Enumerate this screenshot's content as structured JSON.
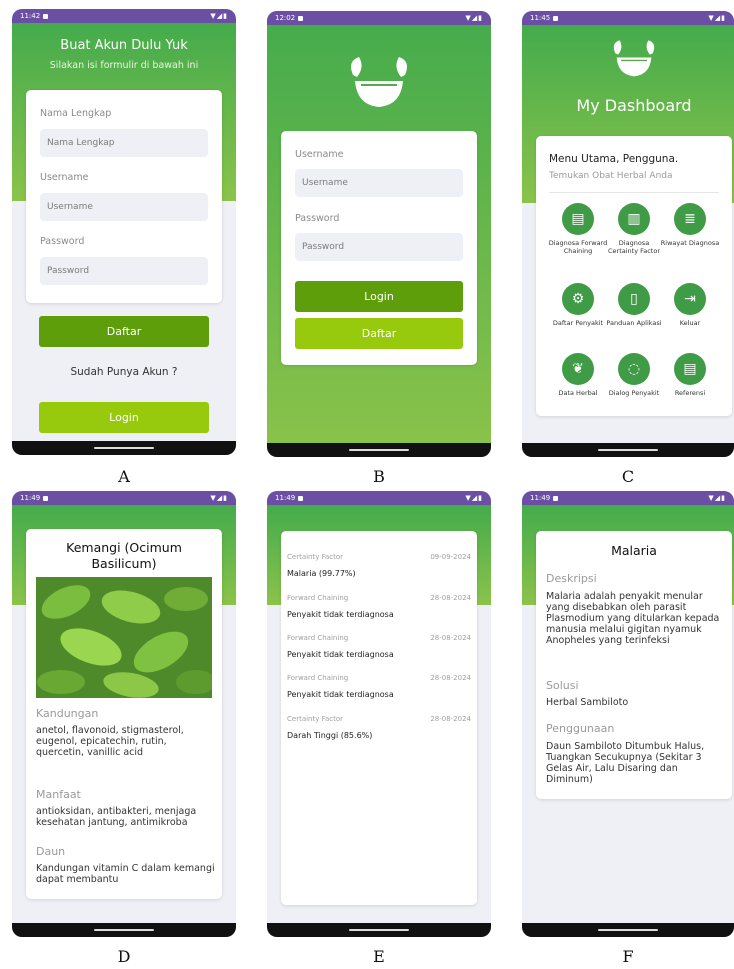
{
  "screens": {
    "a": {
      "time": "11:42",
      "title": "Buat Akun Dulu Yuk",
      "subtitle": "Silakan isi formulir di bawah ini",
      "name_label": "Nama Lengkap",
      "name_placeholder": "Nama Lengkap",
      "username_label": "Username",
      "username_placeholder": "Username",
      "password_label": "Password",
      "password_placeholder": "Password",
      "register_button": "Daftar",
      "have_account": "Sudah Punya Akun ?",
      "login_button": "Login",
      "caption": "A"
    },
    "b": {
      "time": "12:02",
      "username_label": "Username",
      "username_placeholder": "Username",
      "password_label": "Password",
      "password_placeholder": "Password",
      "login_button": "Login",
      "register_button": "Daftar",
      "caption": "B"
    },
    "c": {
      "time": "11:45",
      "title": "My Dashboard",
      "greeting": "Menu Utama, Pengguna.",
      "subgreeting": "Temukan Obat Herbal Anda",
      "menu": [
        {
          "label": "Diagnosa Forward Chaining",
          "icon": "clipboard-icon"
        },
        {
          "label": "Diagnosa Certainty Factor",
          "icon": "clipboard-check-icon"
        },
        {
          "label": "Riwayat Diagnosa",
          "icon": "stack-icon"
        },
        {
          "label": "Daftar Penyakit",
          "icon": "gear-icon"
        },
        {
          "label": "Panduan Aplikasi",
          "icon": "document-icon"
        },
        {
          "label": "Keluar",
          "icon": "logout-icon"
        },
        {
          "label": "Data Herbal",
          "icon": "leaf-icon"
        },
        {
          "label": "Dialog Penyakit",
          "icon": "chat-icon"
        },
        {
          "label": "Referensi",
          "icon": "book-icon"
        }
      ],
      "caption": "C"
    },
    "d": {
      "time": "11:49",
      "title": "Kemangi (Ocimum Basilicum)",
      "kandungan_label": "Kandungan",
      "kandungan_text": "anetol, flavonoid, stigmasterol, eugenol, epicatechin, rutin, quercetin, vanillic acid",
      "manfaat_label": "Manfaat",
      "manfaat_text": "antioksidan, antibakteri, menjaga kesehatan jantung, antimikroba",
      "daun_label": "Daun",
      "daun_text": "Kandungan vitamin C dalam kemangi dapat membantu",
      "caption": "D"
    },
    "e": {
      "time": "11:49",
      "history": [
        {
          "type": "Certainty Factor",
          "date": "09-09-2024",
          "result": "Malaria (99.77%)"
        },
        {
          "type": "Forward Chaining",
          "date": "28-08-2024",
          "result": "Penyakit tidak terdiagnosa"
        },
        {
          "type": "Forward Chaining",
          "date": "28-08-2024",
          "result": "Penyakit tidak terdiagnosa"
        },
        {
          "type": "Forward Chaining",
          "date": "28-08-2024",
          "result": "Penyakit tidak terdiagnosa"
        },
        {
          "type": "Certainty Factor",
          "date": "28-08-2024",
          "result": "Darah Tinggi (85.6%)"
        }
      ],
      "caption": "E"
    },
    "f": {
      "time": "11:49",
      "title": "Malaria",
      "deskripsi_label": "Deskripsi",
      "deskripsi_text": "Malaria adalah penyakit menular yang disebabkan oleh parasit Plasmodium yang ditularkan kepada manusia melalui gigitan nyamuk Anopheles yang terinfeksi",
      "solusi_label": "Solusi",
      "solusi_text": "Herbal Sambiloto",
      "penggunaan_label": "Penggunaan",
      "penggunaan_text": "Daun Sambiloto Ditumbuk Halus, Tuangkan Secukupnya (Sekitar 3 Gelas Air, Lalu Disaring dan Diminum)",
      "caption": "F"
    }
  },
  "colors": {
    "status_bar": "#6a4fa3",
    "green_dark": "#44ab4c",
    "green_light": "#8bc34a",
    "button_dark": "#5e9e0a",
    "button_light": "#97c90d",
    "icon_green": "#3f9b45"
  }
}
